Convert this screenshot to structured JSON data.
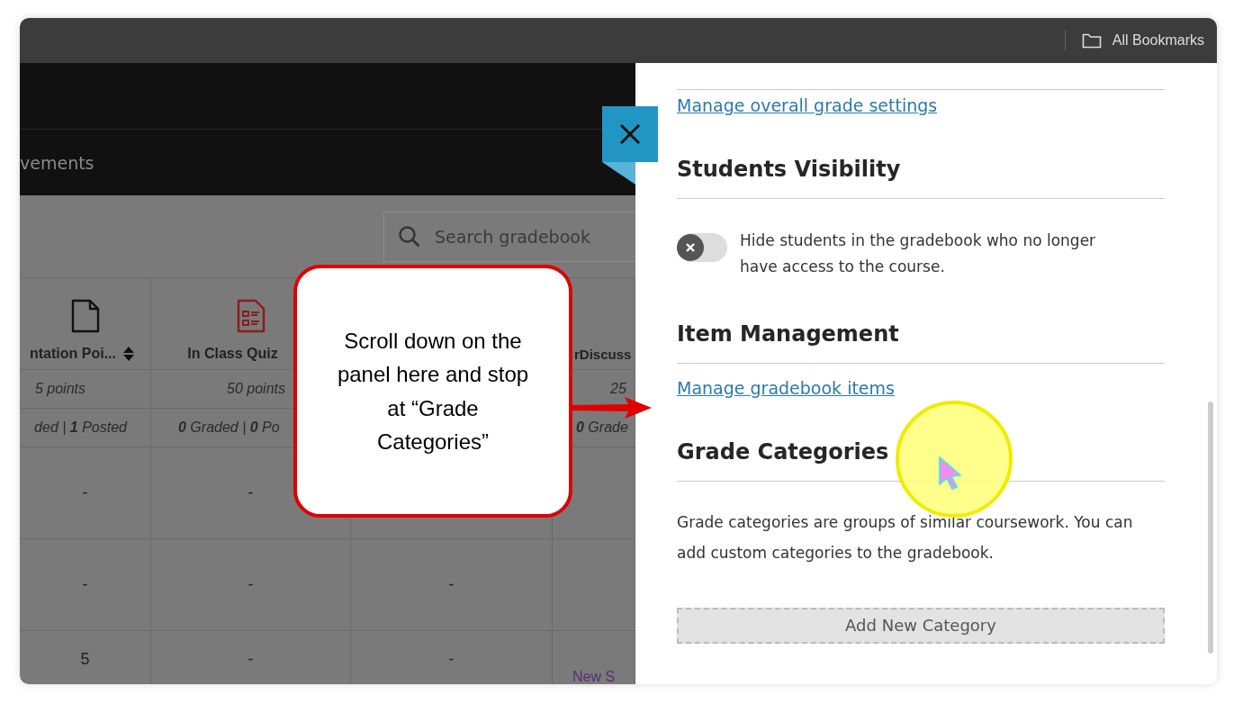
{
  "browser_bar": {
    "bookmarks_label": "All Bookmarks"
  },
  "gradebook": {
    "nav_item": "vements",
    "search": {
      "placeholder": "Search gradebook"
    },
    "columns": [
      {
        "kind": "document",
        "header": "ntation Poi...",
        "sortable": true,
        "points": "5 points",
        "status": "ded | **1** Posted"
      },
      {
        "kind": "quiz",
        "header": "In Class Quiz",
        "sortable": false,
        "points": "50 points",
        "status": "**0** Graded | **0** Po"
      },
      {
        "kind": "covered"
      },
      {
        "kind": "plain",
        "header": "rDiscuss",
        "sortable": false,
        "points": "25",
        "status": "**0** Grade"
      }
    ],
    "rows": [
      {
        "cells": [
          {
            "kind": "text",
            "text": "-"
          },
          {
            "kind": "text",
            "text": "-"
          }
        ]
      },
      {
        "cells": [
          {
            "kind": "text",
            "text": "-"
          },
          {
            "kind": "text",
            "text": "-"
          },
          {
            "kind": "text",
            "text": "-"
          }
        ]
      },
      {
        "cells": [
          {
            "kind": "text",
            "text": "5"
          },
          {
            "kind": "text",
            "text": "-"
          },
          {
            "kind": "text",
            "text": "-"
          },
          {
            "kind": "link",
            "text": "New S"
          }
        ]
      }
    ]
  },
  "panel": {
    "sections": [
      {
        "kind": "link",
        "text": "Manage overall grade settings"
      },
      {
        "kind": "heading",
        "text": "Students Visibility"
      },
      {
        "kind": "toggle",
        "on": false,
        "text": "Hide students in the gradebook who no longer have access to the course."
      },
      {
        "kind": "heading",
        "text": "Item Management"
      },
      {
        "kind": "link",
        "text": "Manage gradebook items"
      },
      {
        "kind": "heading",
        "text": "Grade Categories"
      },
      {
        "kind": "paragraph",
        "text": "Grade categories are groups of similar coursework. You can add custom categories to the gradebook."
      },
      {
        "kind": "button",
        "text": "Add New Category"
      }
    ]
  },
  "callout": {
    "text": "Scroll down on the panel here and stop at “Grade Categories”"
  }
}
